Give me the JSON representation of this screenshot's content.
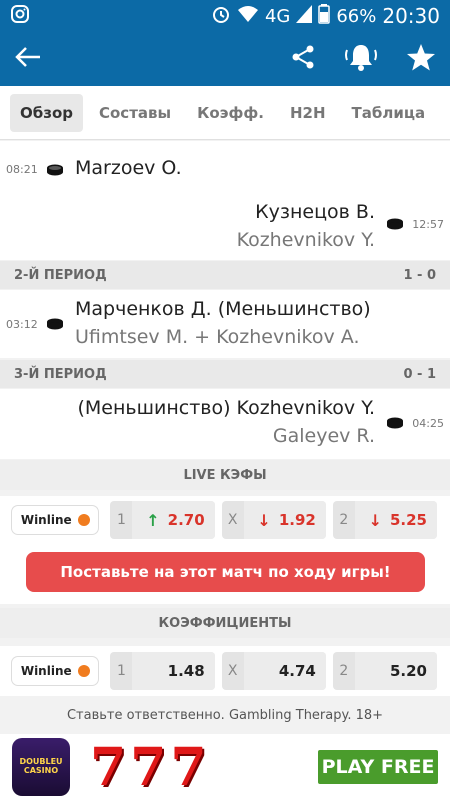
{
  "status_bar": {
    "network": "4G",
    "battery": "66%",
    "time": "20:30"
  },
  "tabs": [
    {
      "label": "Обзор",
      "active": true
    },
    {
      "label": "Составы"
    },
    {
      "label": "Коэфф."
    },
    {
      "label": "H2H"
    },
    {
      "label": "Таблица"
    }
  ],
  "events": [
    {
      "time": "08:21",
      "main": "Marzoev O.",
      "sub": ""
    },
    {
      "time": "12:57",
      "main": "Кузнецов В.",
      "sub": "Kozhevnikov Y."
    },
    {
      "time": "03:12",
      "main": "Марченков Д. (Меньшинство)",
      "sub": "Ufimtsev M. + Kozhevnikov A."
    },
    {
      "time": "04:25",
      "main": "(Меньшинство) Kozhevnikov Y.",
      "sub": "Galeyev R."
    }
  ],
  "periods": [
    {
      "label": "2-Й ПЕРИОД",
      "score": "1 - 0"
    },
    {
      "label": "3-Й ПЕРИОД",
      "score": "0 - 1"
    }
  ],
  "live": {
    "title": "LIVE КЭФЫ",
    "bookmaker": "Winline",
    "odds": [
      {
        "key": "1",
        "value": "2.70",
        "direction": "up"
      },
      {
        "key": "X",
        "value": "1.92",
        "direction": "down"
      },
      {
        "key": "2",
        "value": "5.25",
        "direction": "down"
      }
    ],
    "cta": "Поставьте на этот матч по ходу игры!"
  },
  "prematch": {
    "title": "КОЭФФИЦИЕНТЫ",
    "bookmaker": "Winline",
    "odds": [
      {
        "key": "1",
        "value": "1.48"
      },
      {
        "key": "X",
        "value": "4.74"
      },
      {
        "key": "2",
        "value": "5.20"
      }
    ]
  },
  "responsible": "Ставьте ответственно. Gambling Therapy. 18+",
  "ad": {
    "logo_line1": "DOUBLEU",
    "logo_line2": "CASINO",
    "sevens": "777",
    "play": "PLAY FREE"
  },
  "colors": {
    "primary": "#0c6aa6",
    "cta": "#e74c4c",
    "up": "#2aa148",
    "down": "#d9342b",
    "bookie_dot": "#f07c1f"
  }
}
